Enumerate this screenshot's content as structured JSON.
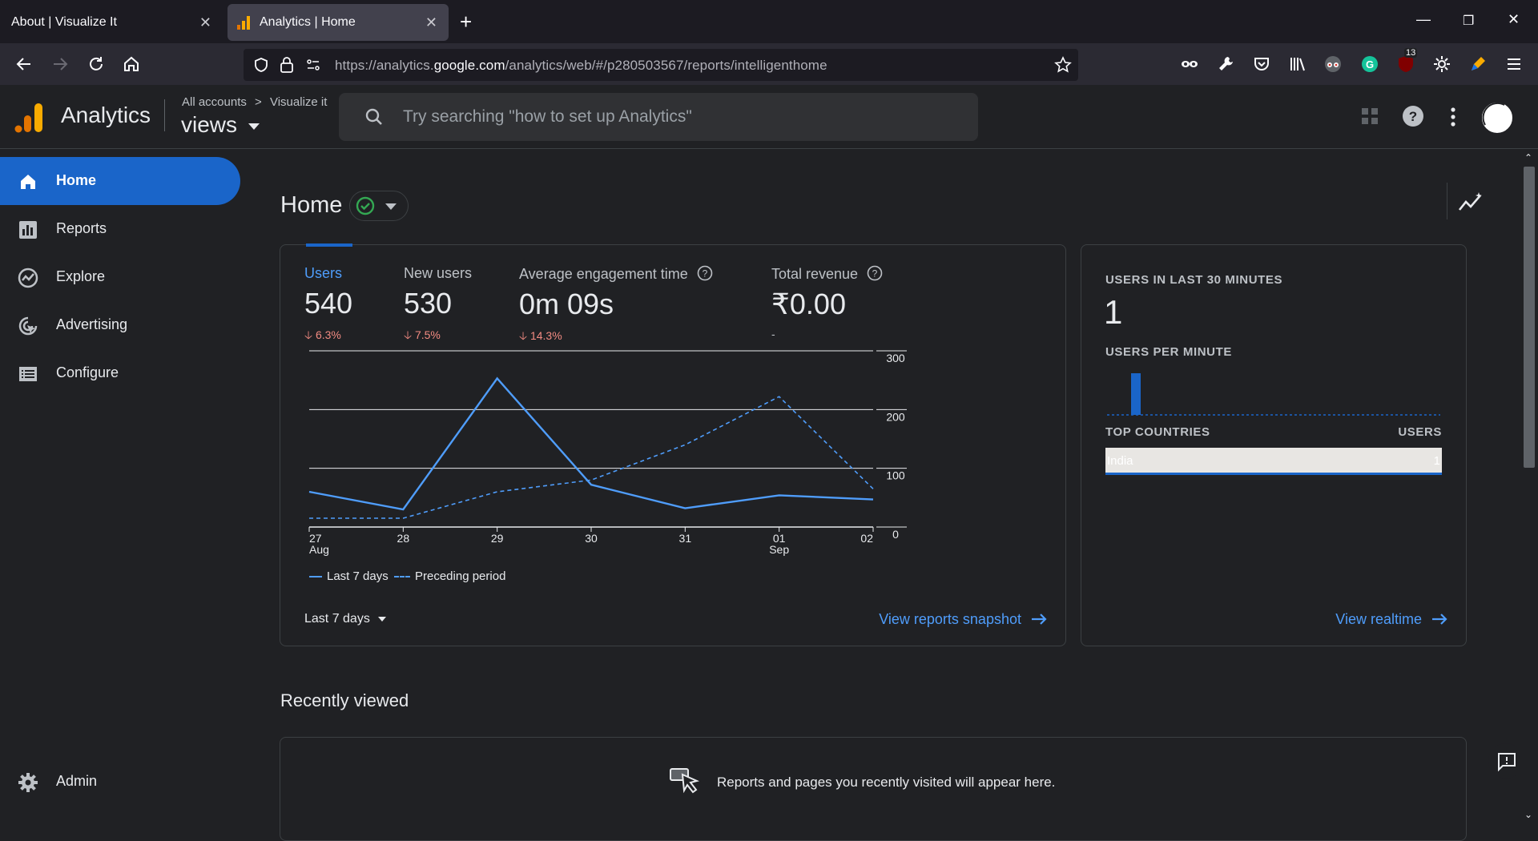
{
  "browser": {
    "tabs": [
      {
        "title": "About | Visualize It"
      },
      {
        "title": "Analytics | Home"
      }
    ],
    "url_prefix": "https://analytics.",
    "url_domain": "google.com",
    "url_path": "/analytics/web/#/p280503567/reports/intelligenthome",
    "notification_badge": "13"
  },
  "header": {
    "product_name": "Analytics",
    "breadcrumb_all": "All accounts",
    "breadcrumb_sep": ">",
    "breadcrumb_account": "Visualize it",
    "property_name": "views",
    "search_placeholder": "Try searching \"how to set up Analytics\""
  },
  "sidebar": {
    "items": [
      {
        "label": "Home",
        "icon": "home-icon",
        "active": true
      },
      {
        "label": "Reports",
        "icon": "reports-icon"
      },
      {
        "label": "Explore",
        "icon": "explore-icon"
      },
      {
        "label": "Advertising",
        "icon": "advertising-icon"
      },
      {
        "label": "Configure",
        "icon": "configure-icon"
      }
    ],
    "admin_label": "Admin"
  },
  "main": {
    "title": "Home",
    "metrics": [
      {
        "label": "Users",
        "value": "540",
        "delta": "6.3%",
        "active": true
      },
      {
        "label": "New users",
        "value": "530",
        "delta": "7.5%"
      },
      {
        "label": "Average engagement time",
        "value": "0m 09s",
        "delta": "14.3%",
        "help": true
      },
      {
        "label": "Total revenue",
        "value": "₹0.00",
        "delta": "-",
        "help": true
      }
    ],
    "legend_current": "Last 7 days",
    "legend_previous": "Preceding period",
    "date_range": "Last 7 days",
    "view_snapshot": "View reports snapshot"
  },
  "chart_data": {
    "type": "line",
    "x": [
      "27 Aug",
      "28",
      "29",
      "30",
      "31",
      "01 Sep",
      "02"
    ],
    "x_ticks_top": [
      "27",
      "28",
      "29",
      "30",
      "31",
      "01",
      "02"
    ],
    "x_ticks_bottom": [
      "Aug",
      "",
      "",
      "",
      "",
      "Sep",
      ""
    ],
    "y_ticks": [
      "300",
      "200",
      "100",
      "0"
    ],
    "ylim": [
      0,
      300
    ],
    "series": [
      {
        "name": "Last 7 days",
        "style": "solid",
        "color": "#4f9dfb",
        "values": [
          60,
          30,
          253,
          72,
          32,
          54,
          47
        ]
      },
      {
        "name": "Preceding period",
        "style": "dashed",
        "color": "#4f9dfb",
        "values": [
          15,
          15,
          60,
          80,
          140,
          222,
          65
        ]
      }
    ]
  },
  "realtime": {
    "users_30_label": "USERS IN LAST 30 MINUTES",
    "users_30_value": "1",
    "per_minute_label": "USERS PER MINUTE",
    "top_countries_label": "TOP COUNTRIES",
    "users_col_label": "USERS",
    "country": "India",
    "country_users": "1",
    "view_realtime": "View realtime"
  },
  "recent": {
    "title": "Recently viewed",
    "empty_message": "Reports and pages you recently visited will appear here."
  },
  "colors": {
    "accent": "#1a65c9",
    "link": "#4f9dfb",
    "negative": "#f28b82",
    "positive_check": "#34a853",
    "logo_orange": "#f9ab00",
    "logo_dark_orange": "#e37400"
  }
}
